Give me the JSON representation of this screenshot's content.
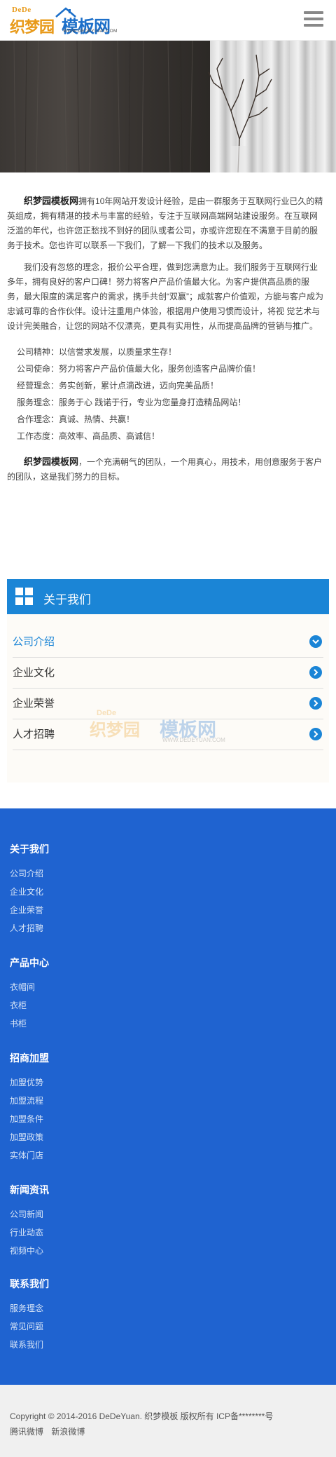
{
  "header": {
    "logo": {
      "dede": "DeDe",
      "name_part1": "织梦园",
      "name_part2": "模板网",
      "url": "WWW.DEDEYUAN.COM"
    },
    "menu_icon": "hamburger-menu-icon"
  },
  "intro": {
    "p1_brand": "织梦园模板网",
    "p1_text": "拥有10年网站开发设计经验，是由一群服务于互联网行业已久的精英组成，拥有精湛的技术与丰富的经验，专注于互联网高端网站建设服务。在互联网泛滥的年代，也许您正愁找不到好的团队或者公司，亦或许您现在不满意于目前的服务于技术。您也许可以联系一下我们，了解一下我们的技术以及服务。",
    "p2_text": "我们没有忽悠的理念，报价公平合理，做到您满意为止。我们服务于互联网行业多年，拥有良好的客户口碑！努力将客户产品价值最大化。为客户提供高品质的服 务，最大限度的满足客户的需求，携手共创“双赢”；成就客户价值观，方能与客户成为忠诚可靠的合作伙伴。设计注重用户体验，根据用户使用习惯而设计，将视 觉艺术与设计完美融合，让您的网站不仅漂亮，更具有实用性，从而提高品牌的营销与推广。",
    "values": [
      "公司精神：以信誉求发展，以质量求生存！",
      "公司使命：努力将客户产品价值最大化，服务创造客户品牌价值！",
      "经营理念：务实创新，累计点滴改进，迈向完美品质！",
      "服务理念：服务于心 践诺于行，专业为您量身打造精品网站！",
      "合作理念：真诚、热情、共赢！",
      "工作态度：高效率、高品质、高诚信！"
    ],
    "p3_brand": "织梦园模板网",
    "p3_text": "，一个充满朝气的团队，一个用真心，用技术，用创意服务于客户的团队，这是我们努力的目标。"
  },
  "about": {
    "title": "关于我们",
    "icon": "grid-icon",
    "items": [
      {
        "label": "公司介绍",
        "active": true
      },
      {
        "label": "企业文化",
        "active": false
      },
      {
        "label": "企业荣誉",
        "active": false
      },
      {
        "label": "人才招聘",
        "active": false
      }
    ],
    "watermark": {
      "dede": "DeDe",
      "name_part1": "织梦园",
      "name_part2": "模板网",
      "url": "WWW.DEDEYUAN.COM"
    }
  },
  "footer_nav": {
    "groups": [
      {
        "title": "关于我们",
        "links": [
          "公司介绍",
          "企业文化",
          "企业荣誉",
          "人才招聘"
        ]
      },
      {
        "title": "产品中心",
        "links": [
          "衣帽间",
          "衣柜",
          "书柜"
        ]
      },
      {
        "title": "招商加盟",
        "links": [
          "加盟优势",
          "加盟流程",
          "加盟条件",
          "加盟政策",
          "实体门店"
        ]
      },
      {
        "title": "新闻资讯",
        "links": [
          "公司新闻",
          "行业动态",
          "视频中心"
        ]
      },
      {
        "title": "联系我们",
        "links": [
          "服务理念",
          "常见问题",
          "联系我们"
        ]
      }
    ]
  },
  "copyright": {
    "line1": "Copyright © 2014-2016 DeDeYuan. 织梦模板 版权所有  ICP备********号",
    "links": [
      "腾讯微博",
      "新浪微博"
    ]
  },
  "colors": {
    "brand_blue": "#1b85d6",
    "footer_blue": "#1f63d0",
    "logo_orange": "#e89a1a"
  }
}
